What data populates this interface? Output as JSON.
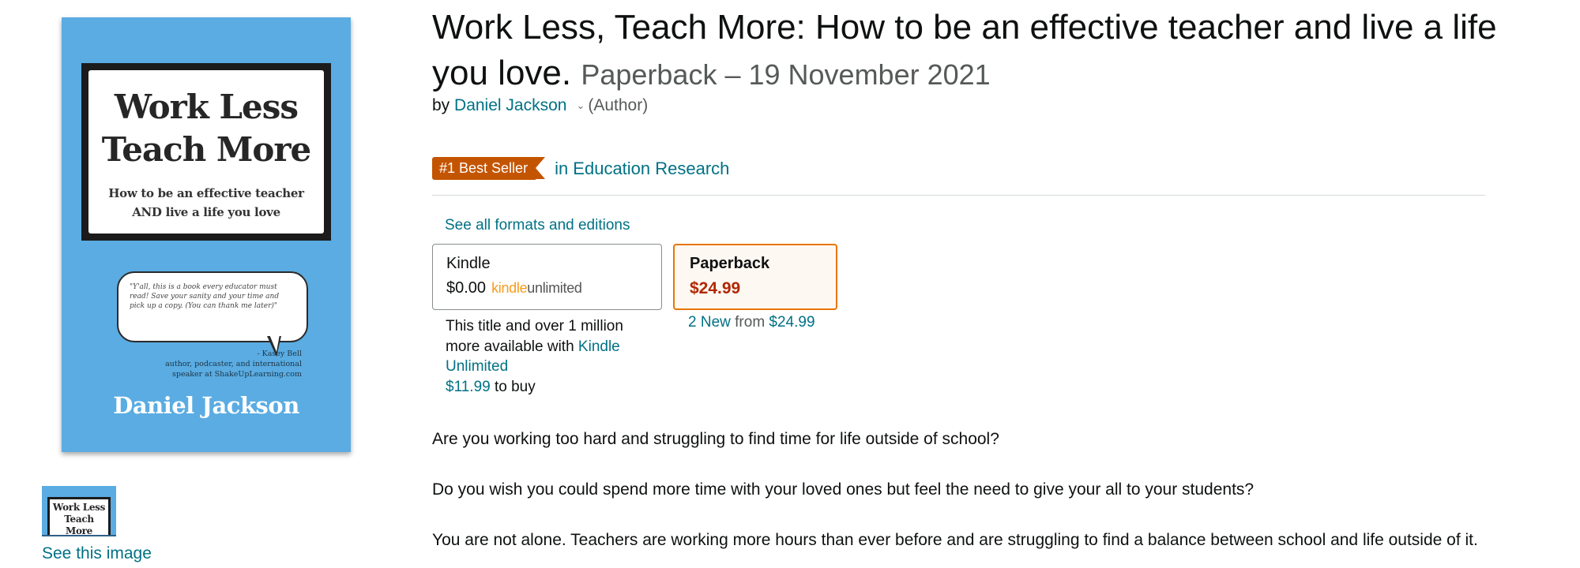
{
  "image": {
    "cover": {
      "title_line1": "Work Less",
      "title_line2": "Teach More",
      "subtitle_line1": "How to be an effective teacher",
      "subtitle_line2": "AND live a life you love",
      "quote": "\"Y'all, this is a book every educator must read! Save your sanity and your time and pick up a copy. (You can thank me later)\"",
      "attribution_name": "- Kasey Bell",
      "attribution_line1": "author, podcaster, and international",
      "attribution_line2": "speaker at ShakeUpLearning.com",
      "author": "Daniel Jackson",
      "background_color": "#5aace2"
    },
    "thumbnail": {
      "title_line1": "Work Less",
      "title_line2": "Teach More"
    },
    "see_image_label": "See this image"
  },
  "product": {
    "title": "Work Less, Teach More: How to be an effective teacher and live a life you love.",
    "format_date": "Paperback – 19 November 2021",
    "by_prefix": "by",
    "author": "Daniel Jackson",
    "author_role": "(Author)",
    "bestseller_badge": "#1 Best Seller",
    "bestseller_category": "in Education Research"
  },
  "formats": {
    "see_all_label": "See all formats and editions",
    "kindle": {
      "name": "Kindle",
      "price": "$0.00",
      "ku_logo_kindle": "kindle",
      "ku_logo_unlimited": "unlimited",
      "note_text": "This title and over 1 million more available with",
      "note_link": "Kindle Unlimited",
      "buy_price": "$11.99",
      "buy_suffix": "to buy"
    },
    "paperback": {
      "name": "Paperback",
      "price": "$24.99",
      "offers_new": "2 New",
      "offers_from": "from",
      "offers_price": "$24.99",
      "selected": true
    }
  },
  "description": {
    "paragraphs": [
      "Are you working too hard and struggling to find time for life outside of school?",
      "Do you wish you could spend more time with your loved ones but feel the need to give your all to your students?",
      "You are not alone. Teachers are working more hours than ever before and are struggling to find a balance between school and life outside of it."
    ]
  },
  "colors": {
    "link": "#007185",
    "badge": "#c45500",
    "price_selected": "#b12704",
    "selected_border": "#e77600"
  }
}
